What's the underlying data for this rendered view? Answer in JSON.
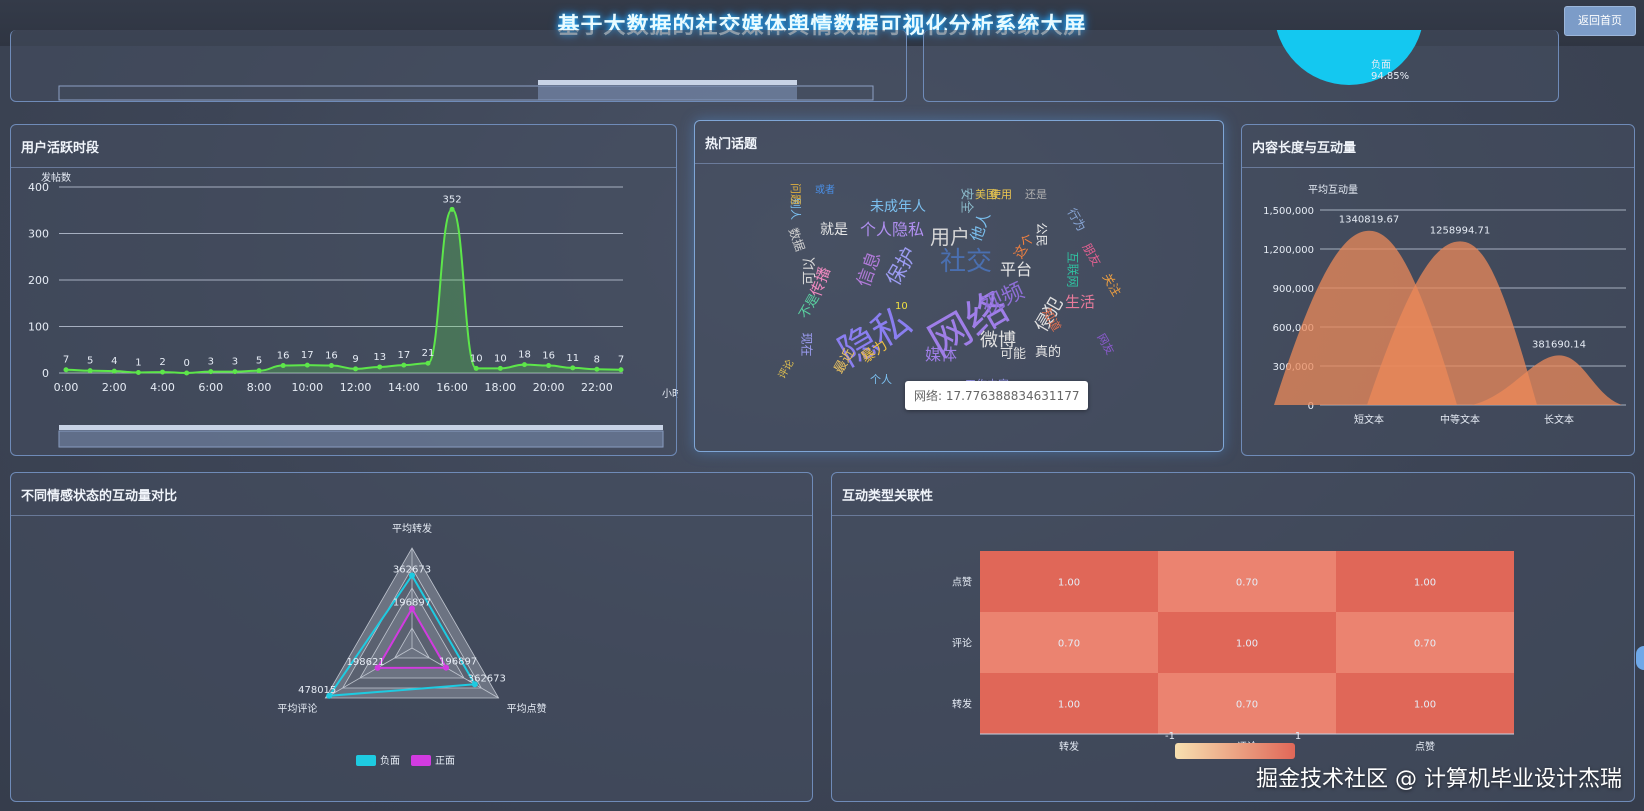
{
  "header": {
    "title": "基于大数据的社交媒体舆情数据可视化分析系统大屏",
    "back_label": "返回首页"
  },
  "sentiment_pie": {
    "label": "负面",
    "percent": "94.85%"
  },
  "activity": {
    "title": "用户活跃时段",
    "ylabel": "发帖数",
    "xunit": "小时",
    "chart_data": {
      "type": "line",
      "x": [
        "0:00",
        "1:00",
        "2:00",
        "3:00",
        "4:00",
        "5:00",
        "6:00",
        "7:00",
        "8:00",
        "9:00",
        "10:00",
        "11:00",
        "12:00",
        "13:00",
        "14:00",
        "15:00",
        "16:00",
        "17:00",
        "18:00",
        "19:00",
        "20:00",
        "21:00",
        "22:00",
        "23:00"
      ],
      "xticks": [
        "0:00",
        "2:00",
        "4:00",
        "6:00",
        "8:00",
        "10:00",
        "12:00",
        "14:00",
        "16:00",
        "18:00",
        "20:00",
        "22:00"
      ],
      "values": [
        7,
        5,
        4,
        1,
        2,
        0,
        3,
        3,
        5,
        16,
        17,
        16,
        9,
        13,
        17,
        21,
        352,
        10,
        10,
        18,
        16,
        11,
        8,
        7
      ],
      "yticks": [
        0,
        100,
        200,
        300,
        400
      ],
      "ylim": [
        0,
        400
      ],
      "color": "#5de64a"
    }
  },
  "topics": {
    "title": "热门话题",
    "tooltip": "网络: 17.776388834631177",
    "words": [
      {
        "t": "网络",
        "c": "#9f7ee8",
        "s": 42
      },
      {
        "t": "隐私",
        "c": "#8a7ef0",
        "s": 38
      },
      {
        "t": "社交",
        "c": "#4a6fb0",
        "s": 26
      },
      {
        "t": "视频",
        "c": "#8f6fd8",
        "s": 22
      },
      {
        "t": "用户",
        "c": "#d6d6d6",
        "s": 20
      },
      {
        "t": "保护",
        "c": "#9c9cf2",
        "s": 20
      },
      {
        "t": "信息",
        "c": "#b07ad8",
        "s": 18
      },
      {
        "t": "微博",
        "c": "#e0e0e0",
        "s": 18
      },
      {
        "t": "侵犯",
        "c": "#e0e0e0",
        "s": 18
      },
      {
        "t": "个人隐私",
        "c": "#b08ff0",
        "s": 16
      },
      {
        "t": "未成年人",
        "c": "#7bc0f0",
        "s": 14
      },
      {
        "t": "媒体",
        "c": "#9f7ee8",
        "s": 16
      },
      {
        "t": "平台",
        "c": "#e8e8e8",
        "s": 16
      },
      {
        "t": "生活",
        "c": "#e87a9a",
        "s": 15
      },
      {
        "t": "就是",
        "c": "#e8e8e8",
        "s": 14
      },
      {
        "t": "传播",
        "c": "#f08ac0",
        "s": 15
      },
      {
        "t": "暴力",
        "c": "#f0c040",
        "s": 14
      },
      {
        "t": "安全",
        "c": "#8ab8c8",
        "s": 13
      },
      {
        "t": "使用",
        "c": "#f0c850",
        "s": 11
      },
      {
        "t": "还是",
        "c": "#b0b0b0",
        "s": 11
      },
      {
        "t": "或者",
        "c": "#4a90e8",
        "s": 10
      },
      {
        "t": "数据",
        "c": "#d0d0d0",
        "s": 12
      },
      {
        "t": "可以",
        "c": "#d8d8d8",
        "s": 14
      },
      {
        "t": "不是",
        "c": "#5ad0a0",
        "s": 13
      },
      {
        "t": "最近",
        "c": "#e8c060",
        "s": 13
      },
      {
        "t": "现在",
        "c": "#9c9cf2",
        "s": 12
      },
      {
        "t": "关注",
        "c": "#f0a040",
        "s": 12
      },
      {
        "t": "朋友",
        "c": "#e06090",
        "s": 12
      },
      {
        "t": "行为",
        "c": "#8aa8d8",
        "s": 12
      },
      {
        "t": "公民",
        "c": "#e8e8e8",
        "s": 12
      },
      {
        "t": "这个",
        "c": "#f08040",
        "s": 13
      },
      {
        "t": "他人",
        "c": "#7bc0f0",
        "s": 15
      },
      {
        "t": "真的",
        "c": "#e8e8e8",
        "s": 13
      },
      {
        "t": "可能",
        "c": "#e0e0e0",
        "s": 13
      },
      {
        "t": "知道",
        "c": "#e07050",
        "s": 12
      },
      {
        "t": "网友",
        "c": "#8c5ad0",
        "s": 11
      },
      {
        "t": "美国",
        "c": "#e0c050",
        "s": 11
      },
      {
        "t": "工作内容",
        "c": "#9c9cf2",
        "s": 11
      },
      {
        "t": "别人",
        "c": "#7bc0f0",
        "s": 11
      },
      {
        "t": "问题",
        "c": "#e0b040",
        "s": 11
      },
      {
        "t": "互联网",
        "c": "#30c0a0",
        "s": 12
      },
      {
        "t": "评论",
        "c": "#e0c050",
        "s": 10
      },
      {
        "t": "个人",
        "c": "#7bc0f0",
        "s": 11
      },
      {
        "t": "10",
        "c": "#f0e040",
        "s": 10
      }
    ]
  },
  "length": {
    "title": "内容长度与互动量",
    "ylabel": "平均互动量",
    "chart_data": {
      "type": "area",
      "categories": [
        "短文本",
        "中等文本",
        "长文本"
      ],
      "values": [
        1340819.67,
        1258994.71,
        381690.14
      ],
      "value_labels": [
        "1340819.67",
        "1258994.71",
        "381690.14"
      ],
      "yticks": [
        0,
        300000,
        600000,
        900000,
        1200000,
        1500000
      ],
      "ytick_labels": [
        "0",
        "300,000",
        "600,000",
        "900,000",
        "1,200,000",
        "1,500,000"
      ],
      "ylim": [
        0,
        1500000
      ],
      "color": "#ec8a5a"
    }
  },
  "radar": {
    "title": "不同情感状态的互动量对比",
    "chart_data": {
      "type": "radar",
      "indicators": [
        "平均转发",
        "平均点赞",
        "平均评论"
      ],
      "series": [
        {
          "name": "负面",
          "values": [
            362673,
            362673,
            478015
          ],
          "labels": [
            "362673",
            "362673",
            "478015"
          ],
          "color": "#1ecbe1"
        },
        {
          "name": "正面",
          "values": [
            196897,
            196897,
            198621
          ],
          "labels": [
            "196897",
            "196897",
            "198621"
          ],
          "color": "#d23be0"
        }
      ]
    }
  },
  "heatmap": {
    "title": "互动类型关联性",
    "chart_data": {
      "type": "heatmap",
      "rows": [
        "点赞",
        "评论",
        "转发"
      ],
      "cols": [
        "转发",
        "评论",
        "点赞"
      ],
      "values": [
        [
          1.0,
          0.7,
          1.0
        ],
        [
          0.7,
          1.0,
          0.7
        ],
        [
          1.0,
          0.7,
          1.0
        ]
      ],
      "labels": [
        [
          "1.00",
          "0.70",
          "1.00"
        ],
        [
          "0.70",
          "1.00",
          "0.70"
        ],
        [
          "1.00",
          "0.70",
          "1.00"
        ]
      ],
      "range": [
        -1,
        1
      ],
      "range_labels": [
        "-1",
        "1"
      ],
      "colors": {
        "high": "#e06758",
        "mid": "#eb8370"
      }
    }
  },
  "watermark": "掘金技术社区 @ 计算机毕业设计杰瑞"
}
